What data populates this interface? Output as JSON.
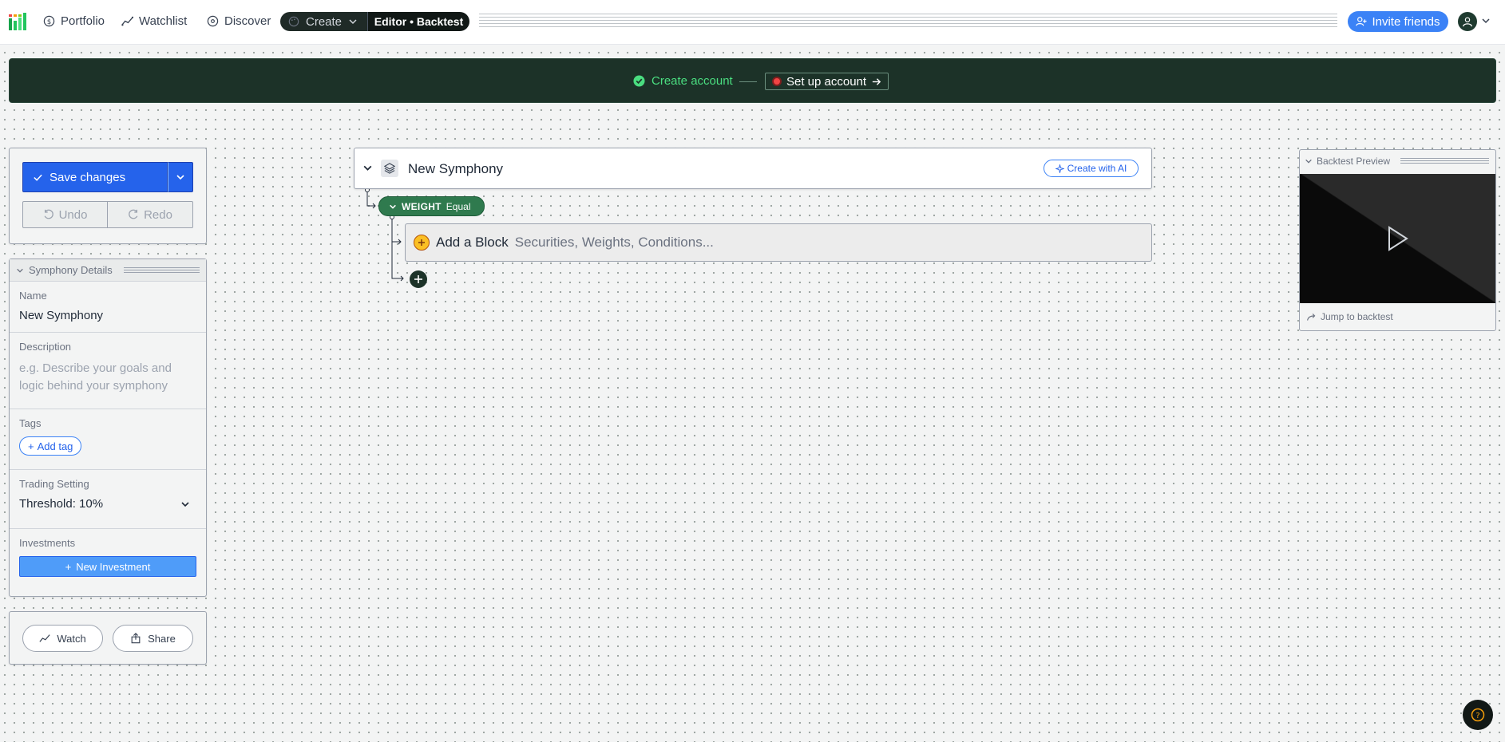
{
  "nav": {
    "items": [
      {
        "label": "Portfolio",
        "icon": "dollar-circle-icon"
      },
      {
        "label": "Watchlist",
        "icon": "trend-line-icon"
      },
      {
        "label": "Discover",
        "icon": "compass-icon"
      }
    ],
    "create_label": "Create",
    "editor_label": "Editor • Backtest",
    "invite_label": "Invite friends"
  },
  "banner": {
    "step1": "Create account",
    "step2": "Set up account"
  },
  "save_panel": {
    "save_label": "Save changes",
    "undo_label": "Undo",
    "redo_label": "Redo"
  },
  "details": {
    "header": "Symphony Details",
    "name_label": "Name",
    "name_value": "New Symphony",
    "description_label": "Description",
    "description_placeholder": "e.g. Describe your goals and logic behind your symphony",
    "tags_label": "Tags",
    "add_tag_label": "Add tag",
    "trading_label": "Trading Setting",
    "trading_value": "Threshold: 10%",
    "investments_label": "Investments",
    "new_investment_label": "New Investment"
  },
  "share_panel": {
    "watch_label": "Watch",
    "share_label": "Share"
  },
  "symphony": {
    "title": "New Symphony",
    "ai_label": "Create with AI",
    "weight_label": "WEIGHT",
    "weight_mode": "Equal",
    "add_block_title": "Add a Block",
    "add_block_sub": "Securities, Weights, Conditions..."
  },
  "backtest": {
    "header": "Backtest Preview",
    "jump_label": "Jump to backtest"
  },
  "colors": {
    "accent_blue": "#3b82f6",
    "banner_green": "#1c3228",
    "weight_green": "#2f7a4e",
    "success_green": "#4ade80"
  }
}
